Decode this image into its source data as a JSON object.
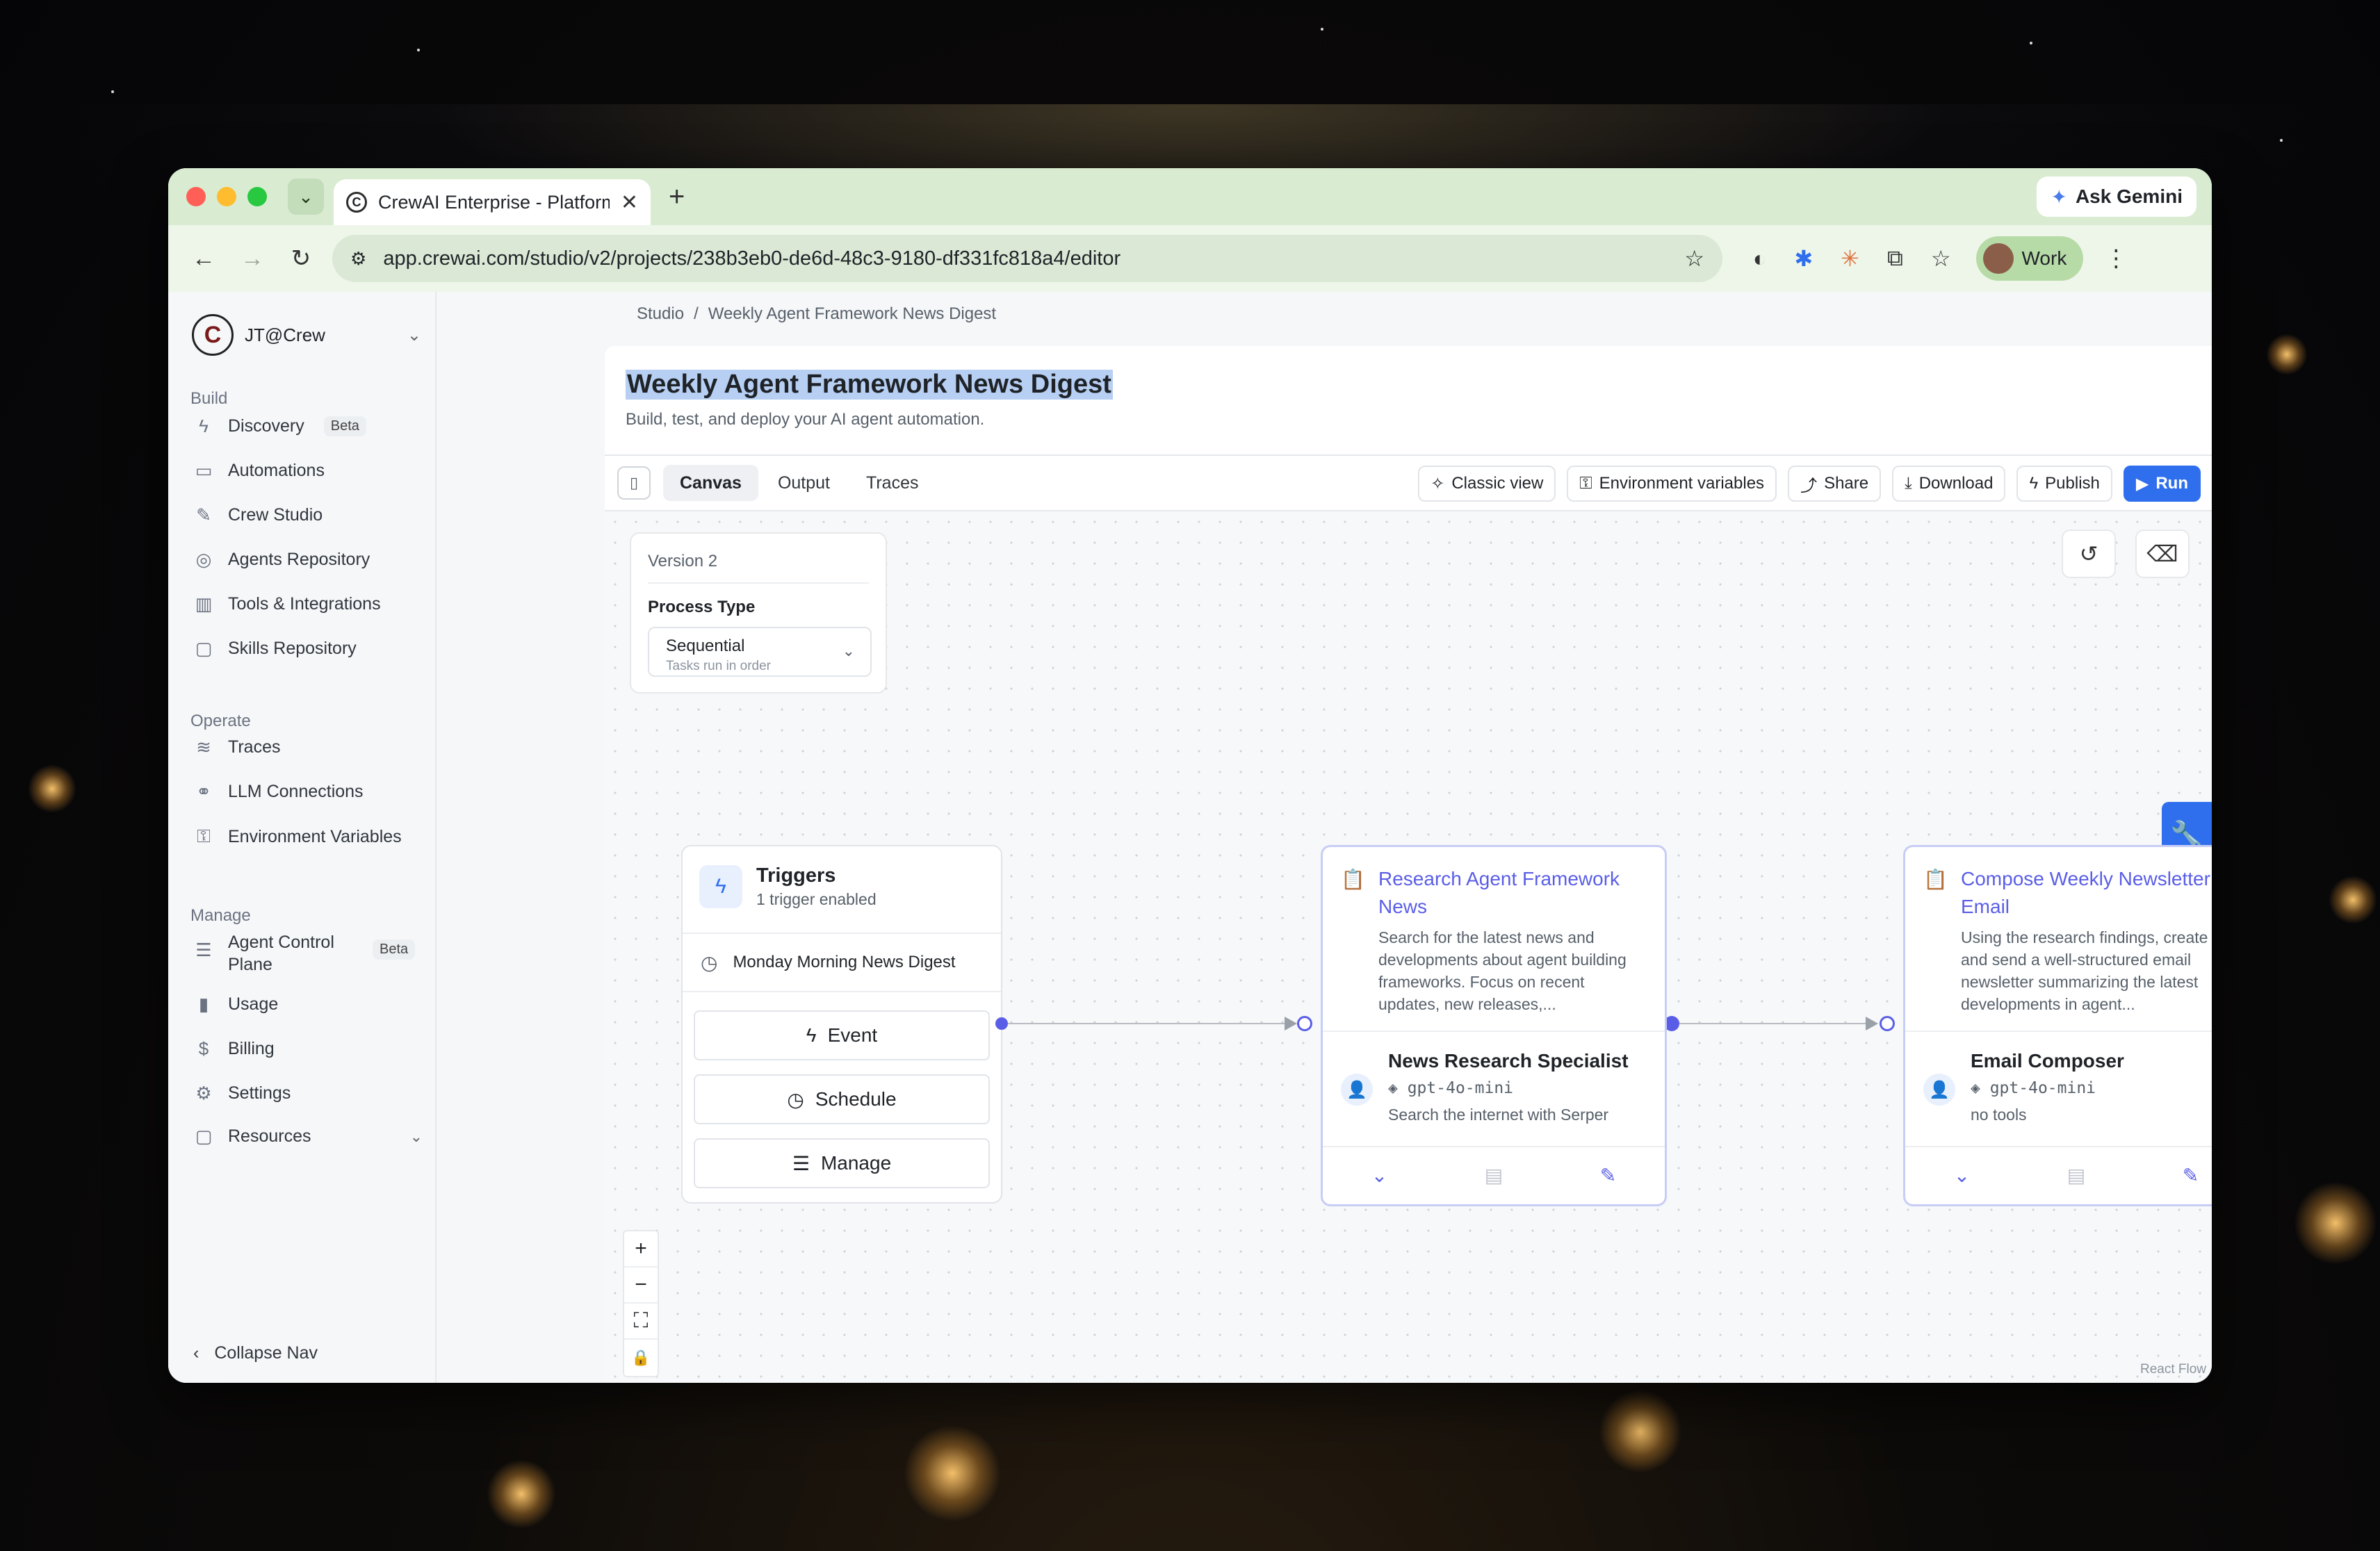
{
  "browser": {
    "tab_title": "CrewAI Enterprise - Platform f",
    "ask_gemini": "Ask Gemini",
    "url": "app.crewai.com/studio/v2/projects/238b3eb0-de6d-48c3-9180-df331fc818a4/editor",
    "profile_label": "Work"
  },
  "sidebar": {
    "org_name": "JT@Crew",
    "sections": {
      "build": "Build",
      "operate": "Operate",
      "manage": "Manage"
    },
    "build_items": [
      {
        "label": "Discovery",
        "badge": "Beta",
        "icon": "bolt-icon"
      },
      {
        "label": "Automations",
        "icon": "monitor-icon"
      },
      {
        "label": "Crew Studio",
        "icon": "pencil-icon"
      },
      {
        "label": "Agents Repository",
        "icon": "agents-icon"
      },
      {
        "label": "Tools & Integrations",
        "icon": "tools-icon"
      },
      {
        "label": "Skills Repository",
        "icon": "folder-icon"
      }
    ],
    "operate_items": [
      {
        "label": "Traces",
        "icon": "traces-icon"
      },
      {
        "label": "LLM Connections",
        "icon": "link-icon"
      },
      {
        "label": "Environment Variables",
        "icon": "key-icon"
      }
    ],
    "manage_items": [
      {
        "label": "Agent Control Plane",
        "badge": "Beta",
        "icon": "database-icon"
      },
      {
        "label": "Usage",
        "icon": "bar-chart-icon"
      },
      {
        "label": "Billing",
        "icon": "dollar-icon"
      },
      {
        "label": "Settings",
        "icon": "gear-icon"
      },
      {
        "label": "Resources",
        "icon": "folder-icon"
      }
    ],
    "collapse_label": "Collapse Nav"
  },
  "breadcrumb": {
    "root": "Studio",
    "sep": "/",
    "current": "Weekly Agent Framework News Digest"
  },
  "page": {
    "title": "Weekly Agent Framework News Digest",
    "subtitle": "Build, test, and deploy your AI agent automation."
  },
  "tabs": [
    "Canvas",
    "Output",
    "Traces"
  ],
  "actions": {
    "classic_view": "Classic view",
    "env_vars": "Environment variables",
    "share": "Share",
    "download": "Download",
    "publish": "Publish",
    "run": "Run"
  },
  "version_panel": {
    "version": "Version 2",
    "process_label": "Process Type",
    "process_value": "Sequential",
    "process_hint": "Tasks run in order"
  },
  "trigger_node": {
    "title": "Triggers",
    "subtitle": "1 trigger enabled",
    "trigger_name": "Monday Morning News Digest",
    "buttons": [
      "Event",
      "Schedule",
      "Manage"
    ]
  },
  "task_nodes": [
    {
      "title": "Research Agent Framework News",
      "description": "Search for the latest news and developments about agent building frameworks. Focus on recent updates, new releases,...",
      "agent_name": "News Research Specialist",
      "model": "gpt-4o-mini",
      "tools": "Search the internet with Serper"
    },
    {
      "title": "Compose Weekly Newsletter Email",
      "description": "Using the research findings, create and send a well-structured email newsletter summarizing the latest developments in agent...",
      "agent_name": "Email Composer",
      "model": "gpt-4o-mini",
      "tools": "no tools"
    }
  ],
  "canvas": {
    "attribution": "React Flow"
  },
  "colors": {
    "accent": "#2f6fed",
    "node_accent": "#5a5ee6",
    "chrome_green": "#d9ecd2"
  }
}
